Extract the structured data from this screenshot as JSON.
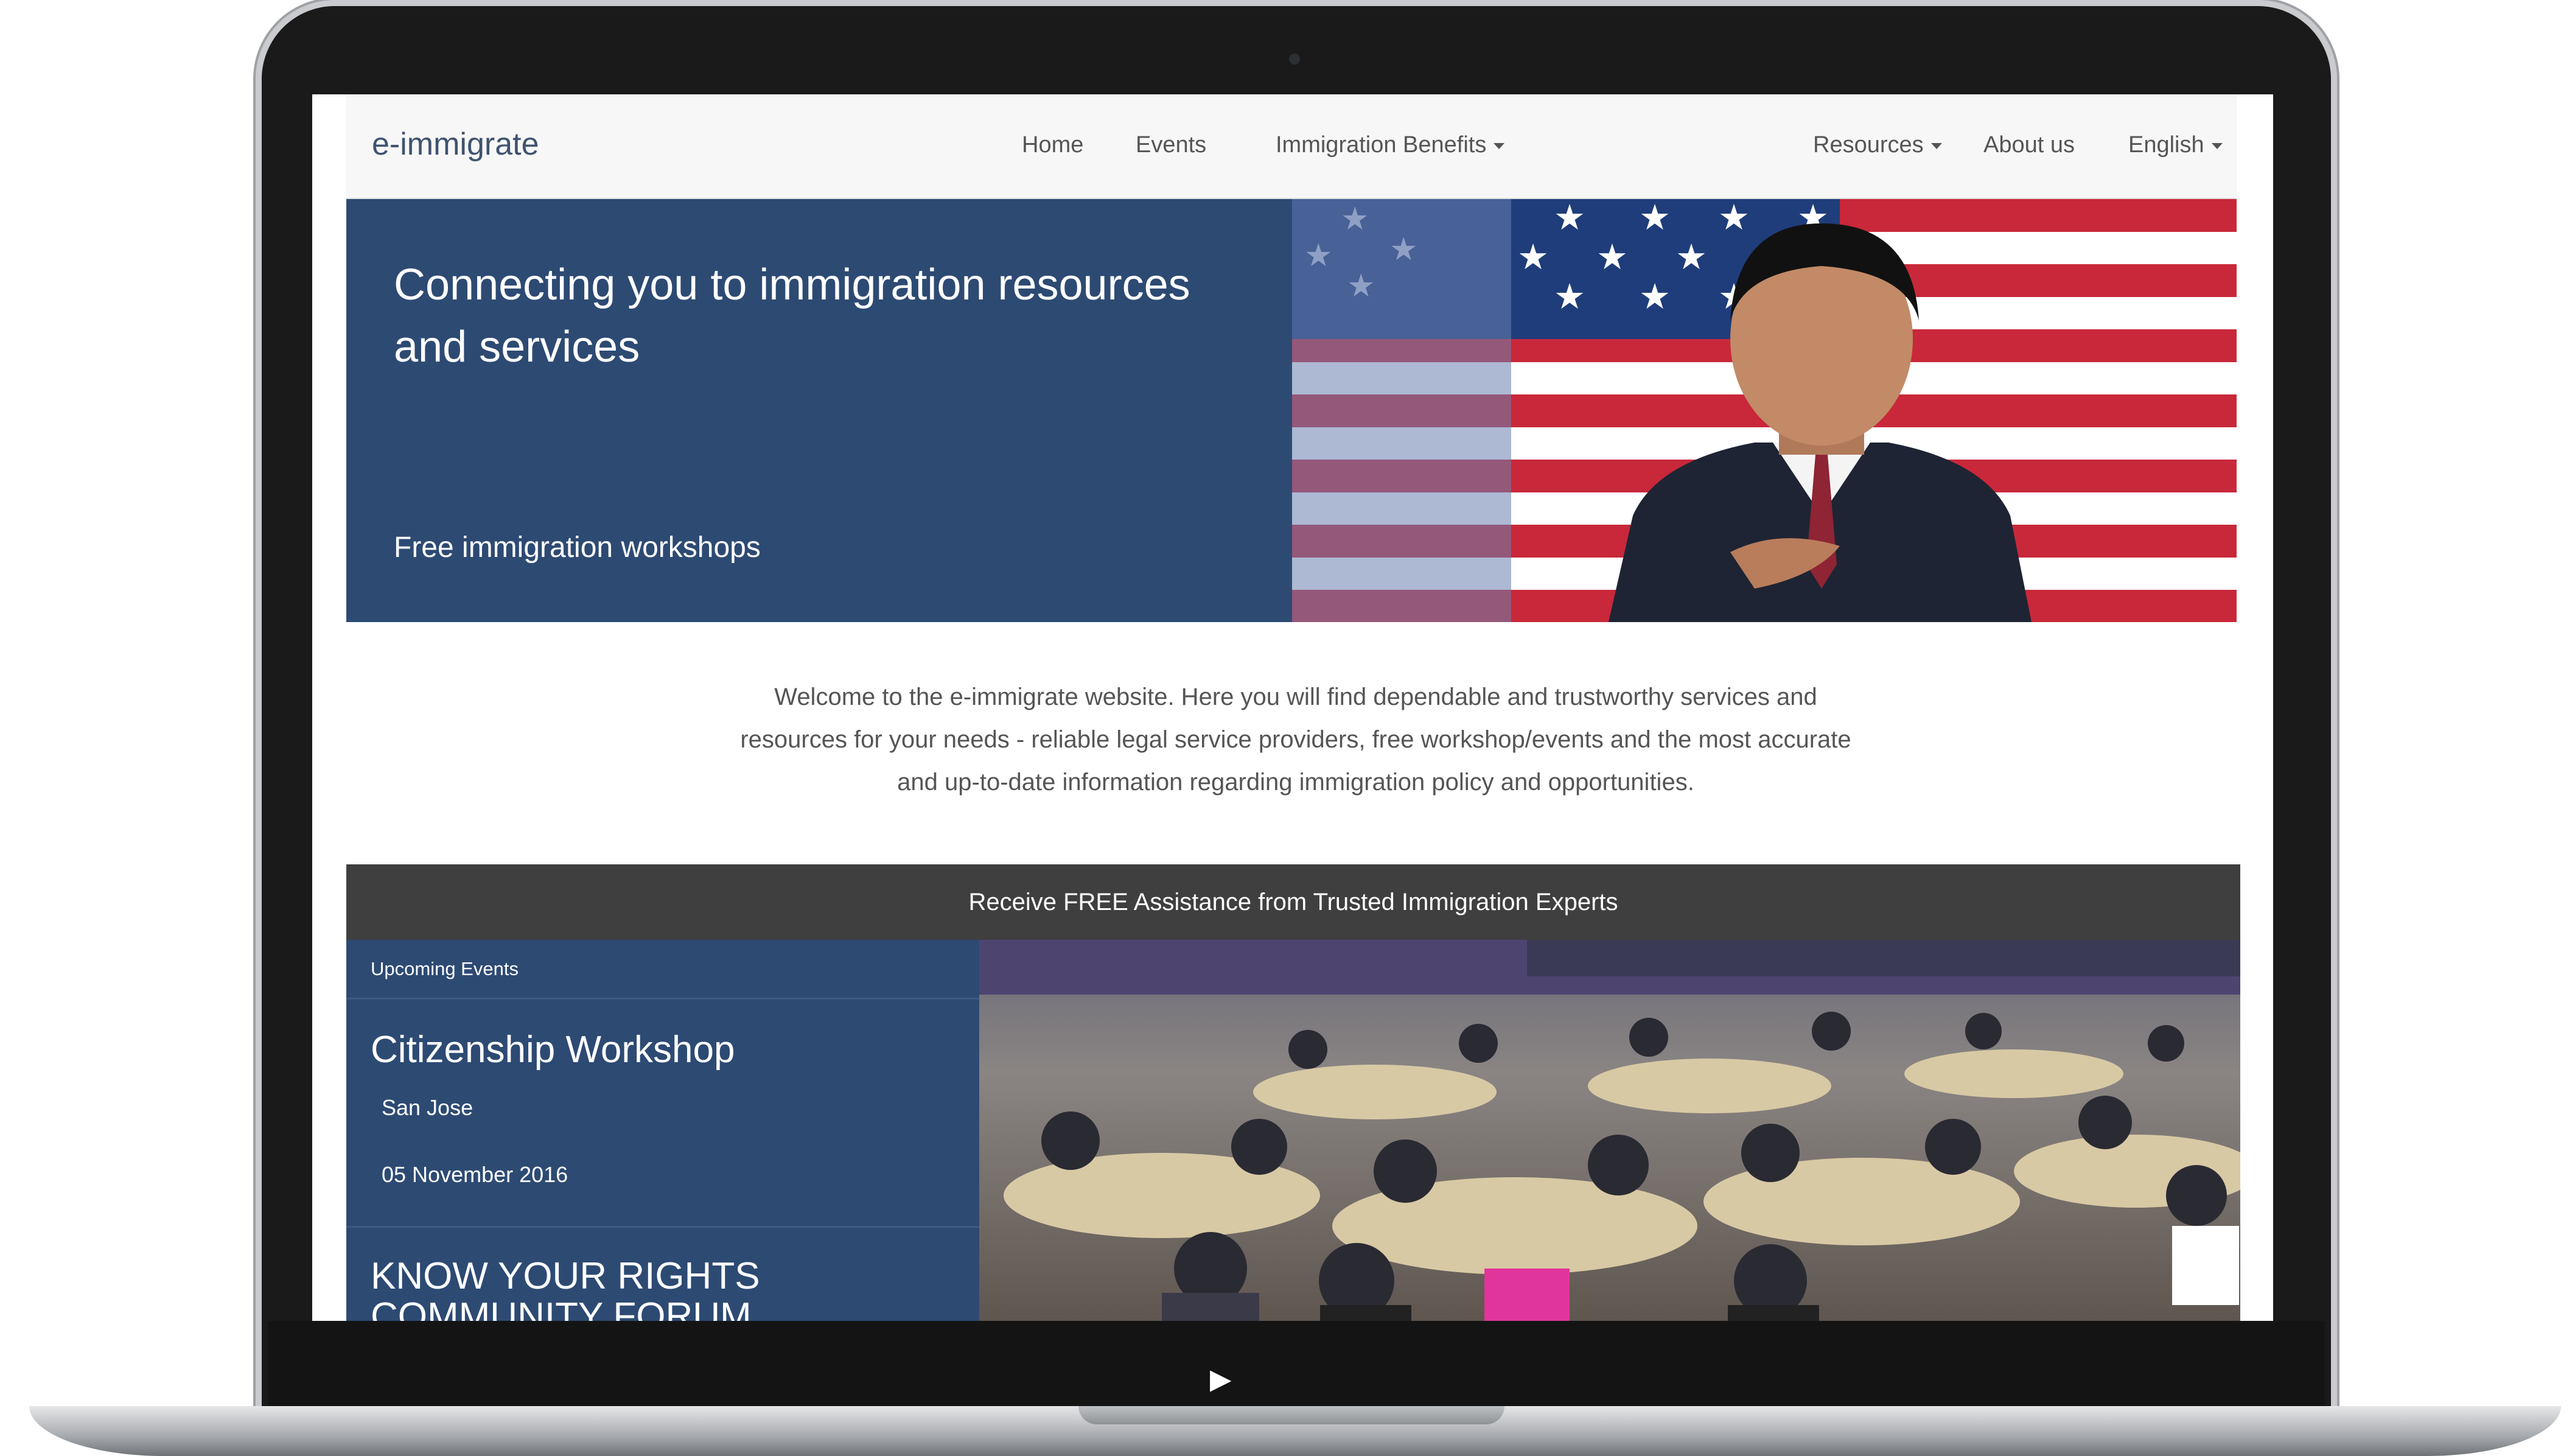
{
  "navbar": {
    "brand": "e-immigrate",
    "items": [
      {
        "label": "Home"
      },
      {
        "label": "Events"
      },
      {
        "label": "Immigration Benefits"
      },
      {
        "label": "Resources"
      },
      {
        "label": "About us"
      },
      {
        "label": "English"
      }
    ]
  },
  "hero": {
    "title": "Connecting you to immigration resources and services",
    "subtitle": "Free immigration workshops"
  },
  "welcome": {
    "text": "Welcome to the e-immigrate website. Here you will find dependable and trustworthy services and resources for your needs - reliable legal service providers, free workshop/events and the most accurate and up-to-date information regarding immigration policy and opportunities."
  },
  "assistance": {
    "banner": "Receive FREE Assistance from Trusted Immigration Experts"
  },
  "events": {
    "heading": "Upcoming Events",
    "items": [
      {
        "title": "Citizenship Workshop",
        "location": "San Jose",
        "date": "05 November 2016"
      },
      {
        "title": "KNOW YOUR RIGHTS COMMUNITY FORUM"
      }
    ]
  },
  "colors": {
    "brand_blue": "#2d4a73",
    "banner_gray": "#3f3f3f",
    "navbar_bg": "#f7f7f7",
    "flag_red": "#c8283a"
  },
  "icons": [
    "caret-down-icon"
  ]
}
